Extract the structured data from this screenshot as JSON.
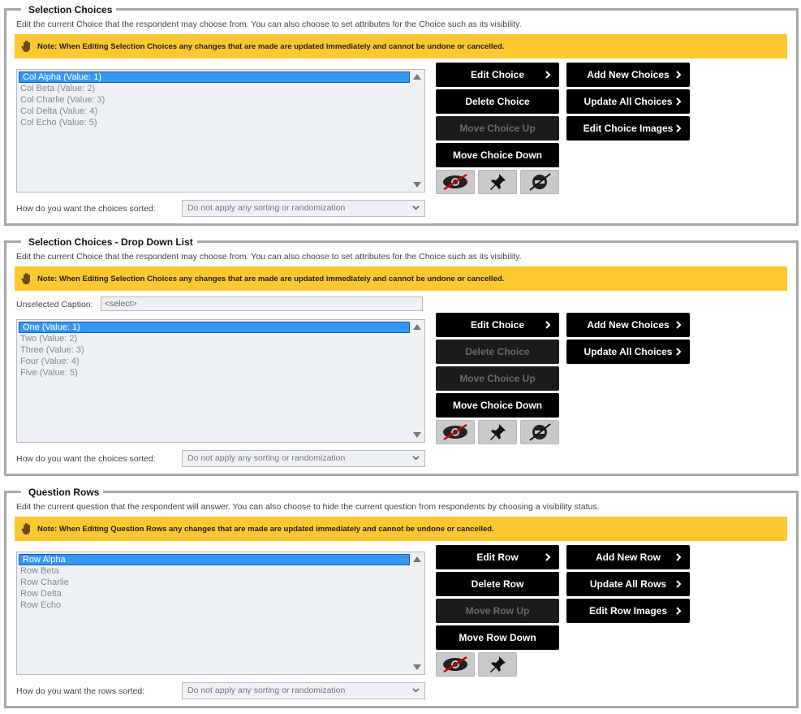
{
  "sections": [
    {
      "title": "Selection Choices",
      "description": "Edit the current Choice that the respondent may choose from. You can also choose to set attributes for the Choice such as its visibility.",
      "note": "Note: When Editing Selection Choices any changes that are made are updated immediately and cannot be undone or cancelled.",
      "items": [
        "Col Alpha (Value: 1)",
        "Col Beta (Value: 2)",
        "Col Charlie (Value: 3)",
        "Col Delta (Value: 4)",
        "Col Echo (Value: 5)"
      ],
      "sort_label": "How do you want the choices sorted:",
      "sort_value": "Do not apply any sorting or randomization",
      "buttons": {
        "edit": "Edit Choice",
        "delete": "Delete Choice",
        "move_up": "Move Choice Up",
        "move_down": "Move Choice Down",
        "add": "Add New Choices",
        "update_all": "Update All Choices",
        "edit_images": "Edit Choice Images"
      }
    },
    {
      "title": "Selection Choices - Drop Down List",
      "description": "Edit the current Choice that the respondent may choose from. You can also choose to set attributes for the Choice such as its visibility.",
      "note": "Note: When Editing Selection Choices any changes that are made are updated immediately and cannot be undone or cancelled.",
      "caption_label": "Unselected Caption:",
      "caption_value": "<select>",
      "items": [
        "One (Value: 1)",
        "Two (Value: 2)",
        "Three (Value: 3)",
        "Four (Value: 4)",
        "Five (Value: 5)"
      ],
      "sort_label": "How do you want the choices sorted:",
      "sort_value": "Do not apply any sorting or randomization",
      "buttons": {
        "edit": "Edit Choice",
        "delete": "Delete Choice",
        "move_up": "Move Choice Up",
        "move_down": "Move Choice Down",
        "add": "Add New Choices",
        "update_all": "Update All Choices"
      }
    },
    {
      "title": "Question Rows",
      "description": "Edit the current question that the respondent will answer. You can also choose to hide the current question from respondents by choosing a visibility status.",
      "note": "Note: When Editing Question Rows any changes that are made are updated immediately and cannot be undone or cancelled.",
      "items": [
        "Row Alpha",
        "Row Beta",
        "Row Charlie",
        "Row Delta",
        "Row Echo"
      ],
      "sort_label": "How do you want the rows sorted:",
      "sort_value": "Do not apply any sorting or randomization",
      "buttons": {
        "edit": "Edit Row",
        "delete": "Delete Row",
        "move_up": "Move Row Up",
        "move_down": "Move Row Down",
        "add": "Add New Row",
        "update_all": "Update All Rows",
        "edit_images": "Edit Row Images"
      }
    }
  ],
  "icons": {
    "hide": "eye-slash-icon",
    "pin": "pushpin-icon",
    "exclude": "ban-icon",
    "hand": "hand-stop-icon",
    "arrow": "chevron-right-icon"
  },
  "colors": {
    "note_bg": "#fdc82f",
    "selected_bg": "#3597f5",
    "button_bg": "#000000",
    "border": "#a8a8a8"
  }
}
